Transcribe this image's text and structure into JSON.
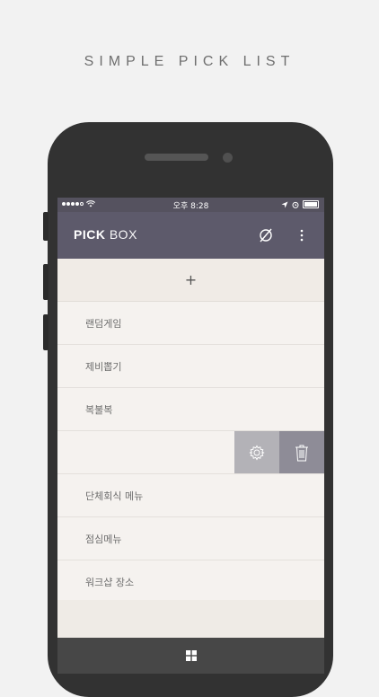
{
  "headline": "SIMPLE PICK LIST",
  "status": {
    "carrier_dots": 5,
    "time": "오후 8:28"
  },
  "appbar": {
    "title_bold": "PICK",
    "title_light": "BOX"
  },
  "add_row": {
    "label": "+"
  },
  "list": {
    "items": [
      {
        "label": "랜덤게임"
      },
      {
        "label": "제비뽑기"
      },
      {
        "label": "복불복"
      },
      {
        "label": ""
      },
      {
        "label": "단체회식 메뉴"
      },
      {
        "label": "점심메뉴"
      },
      {
        "label": "워크샵 장소"
      }
    ]
  },
  "colors": {
    "appbar": "#5d5a6b",
    "settings_action": "#b3b2b7",
    "delete_action": "#8e8c97",
    "bottombar": "#474747"
  },
  "icons": {
    "appbar_left": "empty-set-icon",
    "appbar_right": "more-vert-icon",
    "swipe_settings": "gear-icon",
    "swipe_delete": "trash-icon",
    "bottom": "windows-grid-icon"
  }
}
